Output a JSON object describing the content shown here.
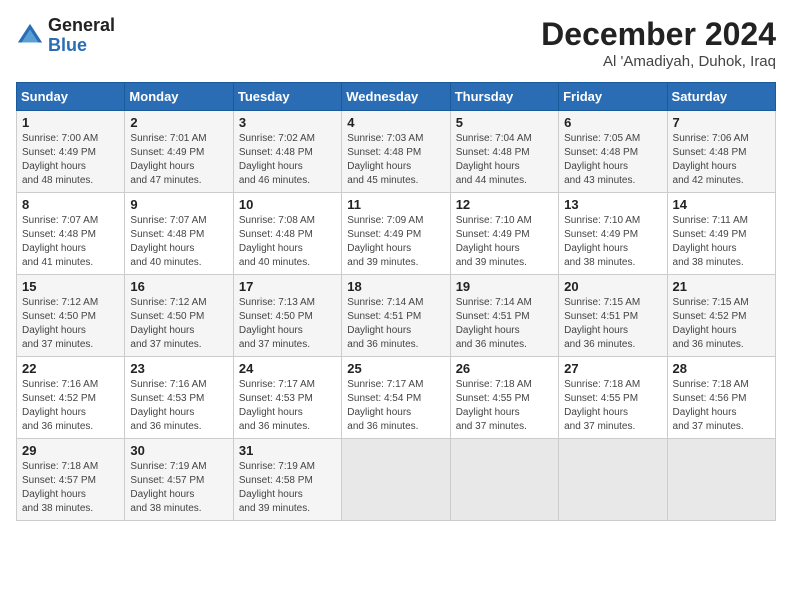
{
  "header": {
    "logo_general": "General",
    "logo_blue": "Blue",
    "title": "December 2024",
    "location": "Al 'Amadiyah, Duhok, Iraq"
  },
  "days_of_week": [
    "Sunday",
    "Monday",
    "Tuesday",
    "Wednesday",
    "Thursday",
    "Friday",
    "Saturday"
  ],
  "weeks": [
    [
      {
        "day": 1,
        "sunrise": "7:00 AM",
        "sunset": "4:49 PM",
        "daylight": "9 hours and 48 minutes."
      },
      {
        "day": 2,
        "sunrise": "7:01 AM",
        "sunset": "4:49 PM",
        "daylight": "9 hours and 47 minutes."
      },
      {
        "day": 3,
        "sunrise": "7:02 AM",
        "sunset": "4:48 PM",
        "daylight": "9 hours and 46 minutes."
      },
      {
        "day": 4,
        "sunrise": "7:03 AM",
        "sunset": "4:48 PM",
        "daylight": "9 hours and 45 minutes."
      },
      {
        "day": 5,
        "sunrise": "7:04 AM",
        "sunset": "4:48 PM",
        "daylight": "9 hours and 44 minutes."
      },
      {
        "day": 6,
        "sunrise": "7:05 AM",
        "sunset": "4:48 PM",
        "daylight": "9 hours and 43 minutes."
      },
      {
        "day": 7,
        "sunrise": "7:06 AM",
        "sunset": "4:48 PM",
        "daylight": "9 hours and 42 minutes."
      }
    ],
    [
      {
        "day": 8,
        "sunrise": "7:07 AM",
        "sunset": "4:48 PM",
        "daylight": "9 hours and 41 minutes."
      },
      {
        "day": 9,
        "sunrise": "7:07 AM",
        "sunset": "4:48 PM",
        "daylight": "9 hours and 40 minutes."
      },
      {
        "day": 10,
        "sunrise": "7:08 AM",
        "sunset": "4:48 PM",
        "daylight": "9 hours and 40 minutes."
      },
      {
        "day": 11,
        "sunrise": "7:09 AM",
        "sunset": "4:49 PM",
        "daylight": "9 hours and 39 minutes."
      },
      {
        "day": 12,
        "sunrise": "7:10 AM",
        "sunset": "4:49 PM",
        "daylight": "9 hours and 39 minutes."
      },
      {
        "day": 13,
        "sunrise": "7:10 AM",
        "sunset": "4:49 PM",
        "daylight": "9 hours and 38 minutes."
      },
      {
        "day": 14,
        "sunrise": "7:11 AM",
        "sunset": "4:49 PM",
        "daylight": "9 hours and 38 minutes."
      }
    ],
    [
      {
        "day": 15,
        "sunrise": "7:12 AM",
        "sunset": "4:50 PM",
        "daylight": "9 hours and 37 minutes."
      },
      {
        "day": 16,
        "sunrise": "7:12 AM",
        "sunset": "4:50 PM",
        "daylight": "9 hours and 37 minutes."
      },
      {
        "day": 17,
        "sunrise": "7:13 AM",
        "sunset": "4:50 PM",
        "daylight": "9 hours and 37 minutes."
      },
      {
        "day": 18,
        "sunrise": "7:14 AM",
        "sunset": "4:51 PM",
        "daylight": "9 hours and 36 minutes."
      },
      {
        "day": 19,
        "sunrise": "7:14 AM",
        "sunset": "4:51 PM",
        "daylight": "9 hours and 36 minutes."
      },
      {
        "day": 20,
        "sunrise": "7:15 AM",
        "sunset": "4:51 PM",
        "daylight": "9 hours and 36 minutes."
      },
      {
        "day": 21,
        "sunrise": "7:15 AM",
        "sunset": "4:52 PM",
        "daylight": "9 hours and 36 minutes."
      }
    ],
    [
      {
        "day": 22,
        "sunrise": "7:16 AM",
        "sunset": "4:52 PM",
        "daylight": "9 hours and 36 minutes."
      },
      {
        "day": 23,
        "sunrise": "7:16 AM",
        "sunset": "4:53 PM",
        "daylight": "9 hours and 36 minutes."
      },
      {
        "day": 24,
        "sunrise": "7:17 AM",
        "sunset": "4:53 PM",
        "daylight": "9 hours and 36 minutes."
      },
      {
        "day": 25,
        "sunrise": "7:17 AM",
        "sunset": "4:54 PM",
        "daylight": "9 hours and 36 minutes."
      },
      {
        "day": 26,
        "sunrise": "7:18 AM",
        "sunset": "4:55 PM",
        "daylight": "9 hours and 37 minutes."
      },
      {
        "day": 27,
        "sunrise": "7:18 AM",
        "sunset": "4:55 PM",
        "daylight": "9 hours and 37 minutes."
      },
      {
        "day": 28,
        "sunrise": "7:18 AM",
        "sunset": "4:56 PM",
        "daylight": "9 hours and 37 minutes."
      }
    ],
    [
      {
        "day": 29,
        "sunrise": "7:18 AM",
        "sunset": "4:57 PM",
        "daylight": "9 hours and 38 minutes."
      },
      {
        "day": 30,
        "sunrise": "7:19 AM",
        "sunset": "4:57 PM",
        "daylight": "9 hours and 38 minutes."
      },
      {
        "day": 31,
        "sunrise": "7:19 AM",
        "sunset": "4:58 PM",
        "daylight": "9 hours and 39 minutes."
      },
      null,
      null,
      null,
      null
    ]
  ]
}
